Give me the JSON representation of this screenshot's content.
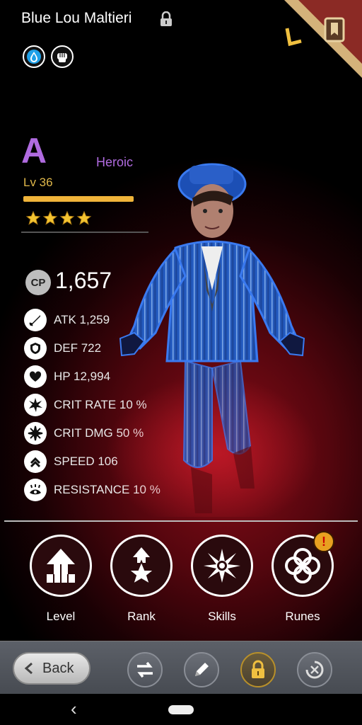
{
  "header": {
    "hero_name": "Blue Lou Maltieri",
    "lock_icon": "padlock-icon",
    "elements": [
      {
        "name": "water-drop-icon"
      },
      {
        "name": "fist-icon"
      }
    ],
    "corner_icon": "book-icon"
  },
  "rank": {
    "grade": "A",
    "rarity": "Heroic",
    "level": "Lv 36",
    "xp_fraction": 1.0,
    "stars": 4
  },
  "cp": {
    "label": "CP",
    "value": "1,657"
  },
  "stats": [
    {
      "icon": "sword-icon",
      "text": "ATK 1,259"
    },
    {
      "icon": "shield-icon",
      "text": "DEF 722"
    },
    {
      "icon": "heart-icon",
      "text": "HP 12,994"
    },
    {
      "icon": "crit-rate-icon",
      "text": "CRIT RATE 10 %"
    },
    {
      "icon": "crit-dmg-icon",
      "text": "CRIT DMG 50 %"
    },
    {
      "icon": "speed-icon",
      "text": "SPEED 106"
    },
    {
      "icon": "resistance-icon",
      "text": "RESISTANCE 10 %"
    }
  ],
  "actions": [
    {
      "label": "Level",
      "icon": "level-up-arrow-icon"
    },
    {
      "label": "Rank",
      "icon": "rank-star-icon"
    },
    {
      "label": "Skills",
      "icon": "skills-burst-icon"
    },
    {
      "label": "Runes",
      "icon": "runes-knot-icon",
      "alert": "!"
    }
  ],
  "toolbar": {
    "back_label": "Back",
    "buttons": [
      "swap-icon",
      "pencil-icon",
      "lock-icon",
      "recycle-icon"
    ]
  },
  "colors": {
    "grade": "#b06be0",
    "level": "#e0b84a",
    "xp": "#f0b43a",
    "star": "#f3c431",
    "alert": "#e8a020"
  }
}
